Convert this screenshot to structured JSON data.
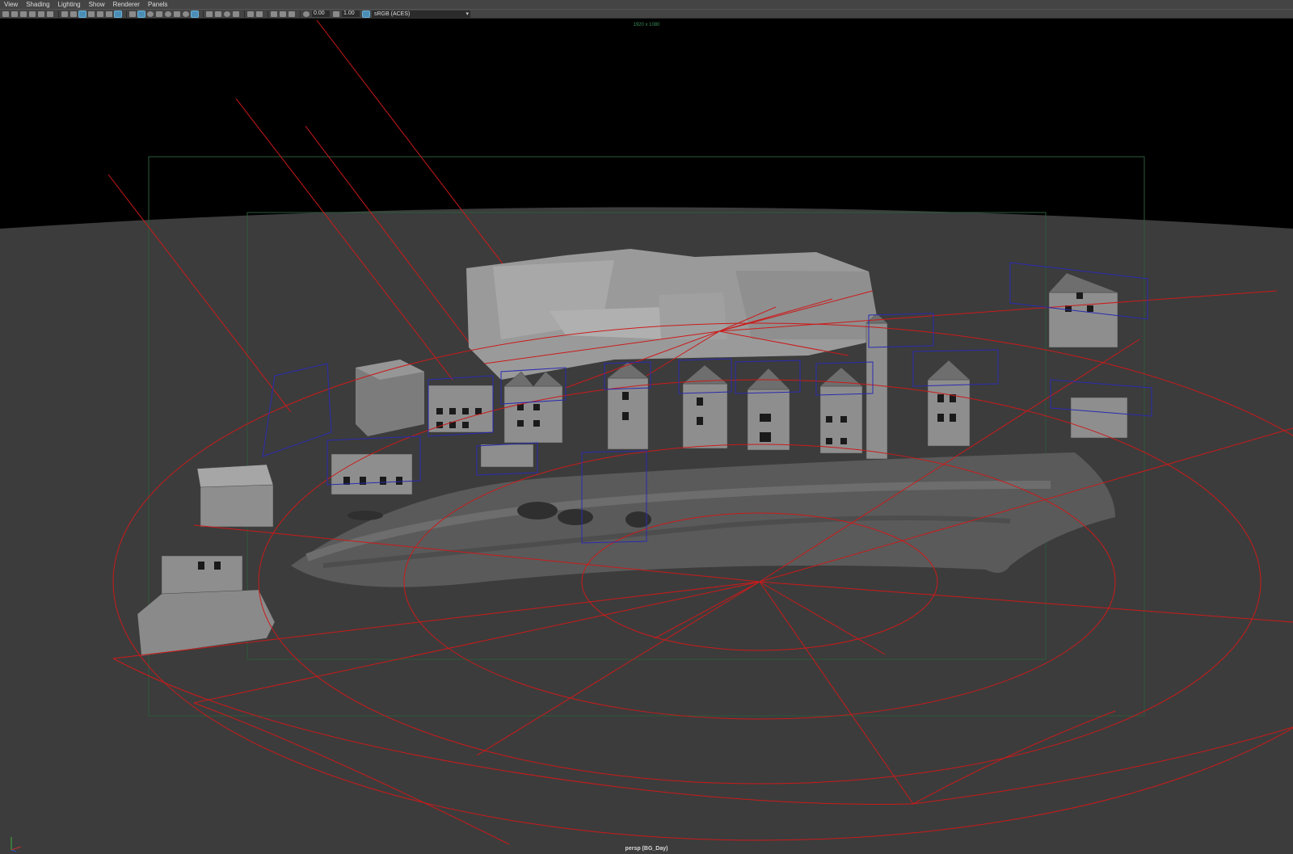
{
  "menu": [
    "View",
    "Shading",
    "Lighting",
    "Show",
    "Renderer",
    "Panels"
  ],
  "toolbar": {
    "exposure_value": "0.00",
    "gamma_value": "1.00",
    "color_space": "sRGB (ACES)"
  },
  "viewport": {
    "resolution_label": "1920 x 1080",
    "camera_label": "persp (BG_Day)"
  },
  "colors": {
    "background": "#000000",
    "ground": "#3c3c3c",
    "light_wire": "#cc1a1a",
    "bounding_box": "#2a2ab0",
    "gate": "#2c5a3a",
    "geometry": "#8a8a8a"
  }
}
